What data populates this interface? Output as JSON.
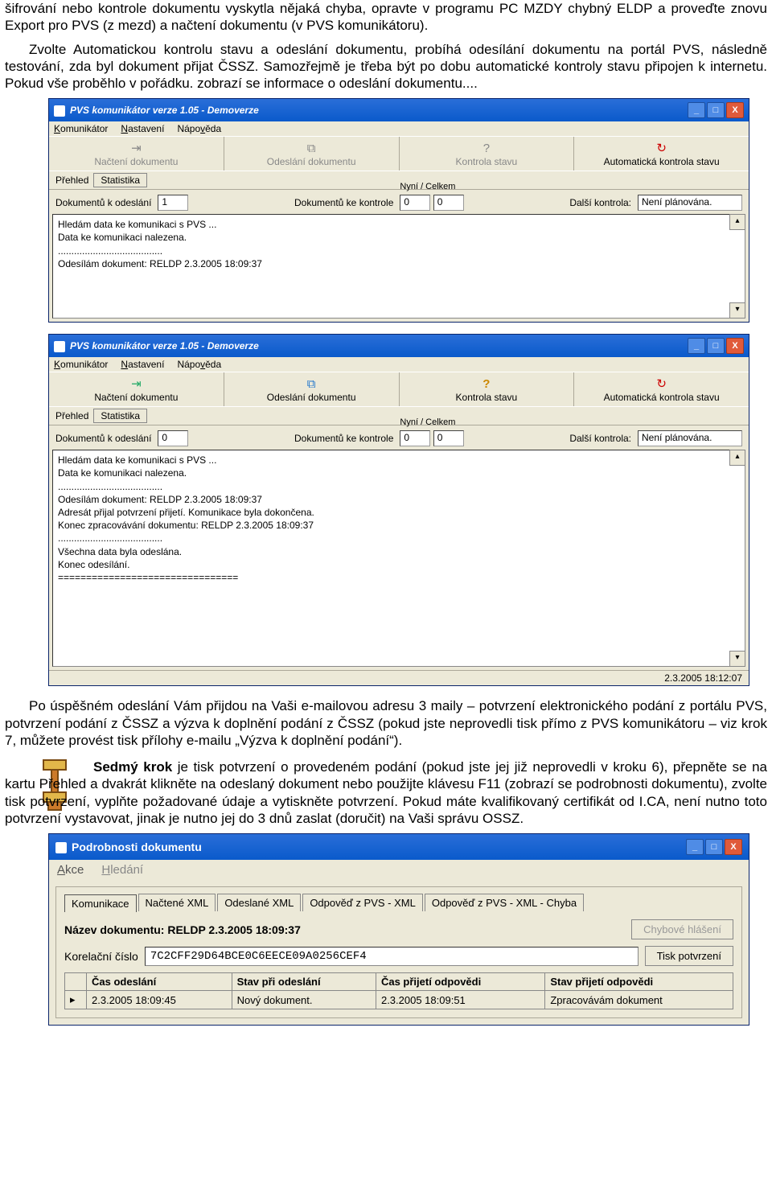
{
  "para1": "šifrování nebo kontrole dokumentu vyskytla nějaká chyba, opravte v programu PC MZDY chybný ELDP a proveďte znovu Export pro PVS (z mezd) a načtení dokumentu (v PVS komunikátoru).",
  "para2": "Zvolte Automatickou kontrolu stavu a odeslání dokumentu, probíhá odesílání dokumentu na portál PVS, následně testování, zda byl dokument přijat ČSSZ. Samozřejmě je třeba být po dobu automatické kontroly stavu připojen k internetu. Pokud vše proběhlo v pořádku. zobrazí se informace o odeslání dokumentu....",
  "win": {
    "title": "PVS komunikátor verze 1.05 - Demoverze",
    "menu": {
      "m1": "Komunikátor",
      "m2": "Nastavení",
      "m3": "Nápověda"
    },
    "tools": {
      "t1": "Načtení dokumentu",
      "t2": "Odeslání dokumentu",
      "t3": "Kontrola stavu",
      "t4": "Automatická kontrola stavu"
    },
    "tabs": {
      "prehled": "Přehled",
      "statistika": "Statistika"
    },
    "counters": {
      "nyni": "Nyní / Celkem",
      "l1": "Dokumentů k odeslání",
      "v1_a": "1",
      "v1_b": "0",
      "l2": "Dokumentů ke kontrole",
      "v2a": "0",
      "v2b": "0",
      "l3": "Další kontrola:",
      "v3": "Není plánována."
    },
    "log1": [
      "Hledám data ke komunikaci s PVS ...",
      "Data ke komunikaci nalezena.",
      ".......................................",
      "Odesílám dokument: RELDP 2.3.2005 18:09:37"
    ],
    "log2": [
      "Hledám data ke komunikaci s PVS ...",
      "Data ke komunikaci nalezena.",
      ".......................................",
      "Odesílám dokument: RELDP 2.3.2005 18:09:37",
      "Adresát přijal potvrzení přijetí. Komunikace byla dokončena.",
      "Konec zpracovávání dokumentu: RELDP 2.3.2005 18:09:37",
      ".......................................",
      "Všechna data byla odeslána.",
      "Konec odesílání.",
      "================================"
    ],
    "status_time": "2.3.2005 18:12:07"
  },
  "para3": "Po úspěšném odeslání Vám přijdou na Vaši e-mailovou adresu 3 maily – potvrzení elektronického podání z portálu PVS, potvrzení podání z ČSSZ a výzva k doplnění podání z ČSSZ (pokud jste neprovedli tisk přímo z PVS komunikátoru – viz krok 7, můžete provést tisk přílohy e-mailu „Výzva k doplnění podání“).",
  "krok7_lead": "Sedmý krok",
  "para4": " je tisk potvrzení o provedeném podání (pokud jste jej již neprovedli v kroku 6), přepněte se na kartu Přehled a dvakrát klikněte na odeslaný dokument nebo použijte klávesu F11 (zobrazí se podrobnosti dokumentu), zvolte tisk potvrzení, vyplňte požadované údaje a vytiskněte potvrzení. Pokud máte kvalifikovaný certifikát od I.CA, není nutno toto potvrzení vystavovat, jinak je nutno jej do 3 dnů zaslat (doručit) na Vaši správu OSSZ.",
  "win3": {
    "title": "Podrobnosti dokumentu",
    "menu": {
      "m1": "Akce",
      "m2": "Hledání"
    },
    "tabs": {
      "t1": "Komunikace",
      "t2": "Načtené XML",
      "t3": "Odeslané XML",
      "t4": "Odpověď z PVS - XML",
      "t5": "Odpověď z PVS - XML - Chyba"
    },
    "doc_label": "Název dokumentu: RELDP 2.3.2005 18:09:37",
    "btn_err": "Chybové hlášení",
    "kor_label": "Korelační číslo",
    "kor_value": "7C2CFF29D64BCE0C6EECE09A0256CEF4",
    "btn_print": "Tisk potvrzení",
    "tbl": {
      "h1": "Čas odeslání",
      "h2": "Stav při odeslání",
      "h3": "Čas přijetí odpovědi",
      "h4": "Stav přijetí odpovědi",
      "r1c1": "2.3.2005 18:09:45",
      "r1c2": "Nový dokument.",
      "r1c3": "2.3.2005 18:09:51",
      "r1c4": "Zpracovávám dokument"
    }
  }
}
